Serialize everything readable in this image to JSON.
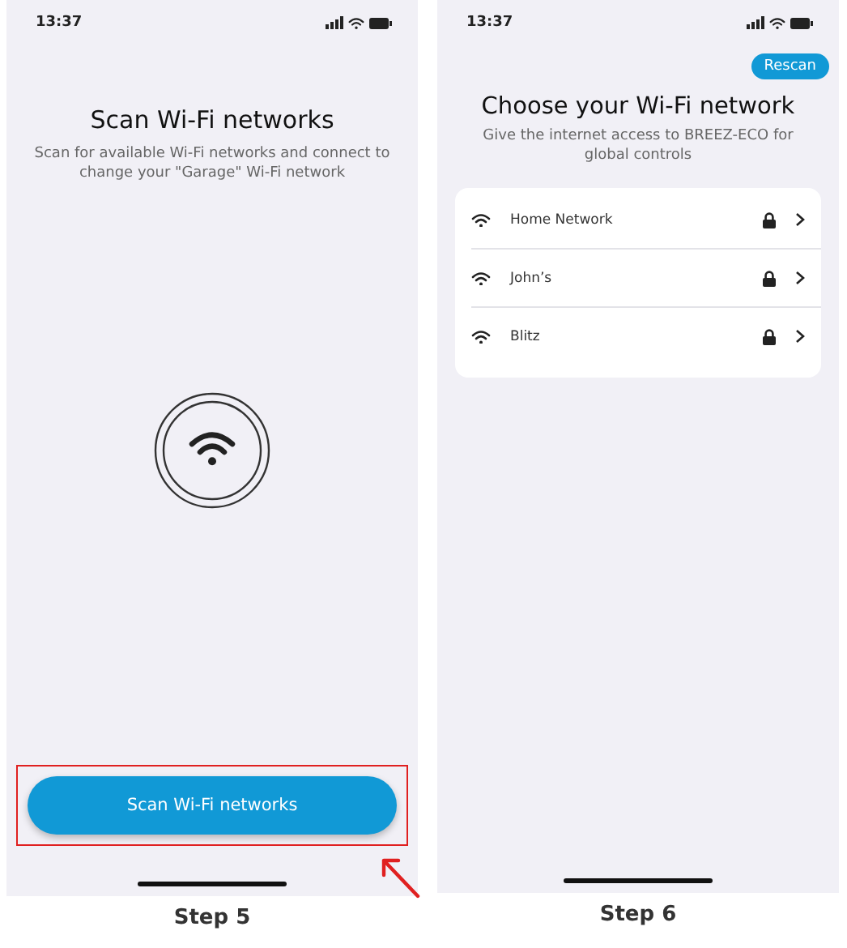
{
  "steps": [
    {
      "kind": "scan",
      "caption": "Step 5",
      "status_bar": {
        "time": "13:37"
      },
      "title": "Scan Wi-Fi networks",
      "subtitle": "Scan for available Wi-Fi networks and connect to change your \"Garage\" Wi-Fi network",
      "button": {
        "label": "Scan Wi-Fi networks",
        "highlighted": true
      }
    },
    {
      "kind": "list",
      "caption": "Step 6",
      "status_bar": {
        "time": "13:37"
      },
      "rescan_button": "Rescan",
      "title": "Choose your Wi-Fi network",
      "subtitle": "Give the internet access to BREEZ-ECO for global controls",
      "networks": [
        {
          "name": "Home Network",
          "secured": true
        },
        {
          "name": "John’s",
          "secured": true
        },
        {
          "name": "Blitz",
          "secured": true
        }
      ]
    }
  ]
}
